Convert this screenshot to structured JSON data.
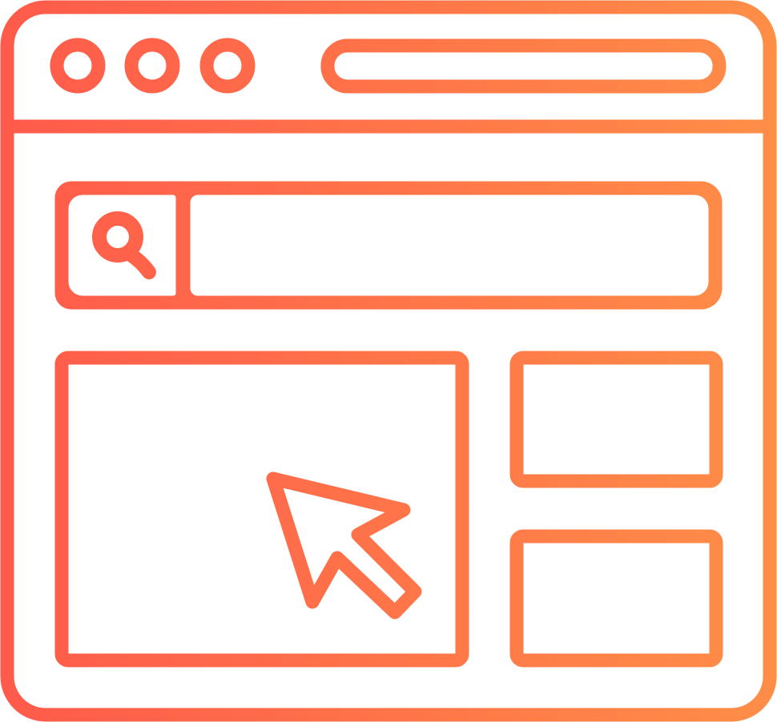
{
  "icon": {
    "name": "browser-window-icon",
    "gradient_start": "#FF5A4B",
    "gradient_end": "#FF8E47",
    "background": "#FFFFFF"
  },
  "title_bar": {
    "window_controls": [
      "close-dot",
      "minimize-dot",
      "maximize-dot"
    ],
    "address_bar_text": ""
  },
  "search": {
    "icon": "search-icon",
    "value": ""
  },
  "content": {
    "main_panel": "image-panel",
    "cursor": "cursor-arrow-icon",
    "side_panels": [
      "side-panel-top",
      "side-panel-bottom"
    ]
  }
}
